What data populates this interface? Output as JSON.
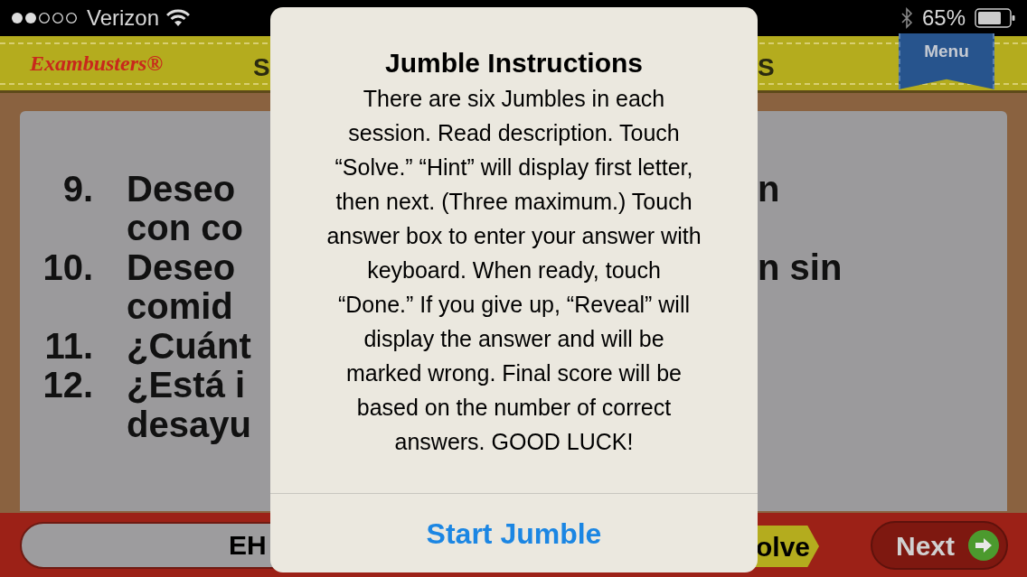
{
  "status_bar": {
    "carrier": "Verizon",
    "battery": "65%"
  },
  "header": {
    "logo": "Exambusters®",
    "title_left_fragment": "S",
    "title_right_fragment": "S",
    "menu": "Menu"
  },
  "items": [
    {
      "number": "9.",
      "lines": [
        {
          "left": "Deseo",
          "right": "n"
        },
        {
          "left": "con co"
        }
      ]
    },
    {
      "number": "10.",
      "lines": [
        {
          "left": "Deseo",
          "right": "n sin"
        },
        {
          "left": "comid"
        }
      ]
    },
    {
      "number": "11.",
      "lines": [
        {
          "left": "¿Cuánt"
        }
      ]
    },
    {
      "number": "12.",
      "lines": [
        {
          "left": "¿Está i"
        },
        {
          "left": "desayu"
        }
      ]
    }
  ],
  "bottom_bar": {
    "answer_field": "EH",
    "solve_button": "olve",
    "next_button": "Next"
  },
  "alert": {
    "title": "Jumble Instructions",
    "message": "There are six Jumbles in each session. Read description. Touch “Solve.” “Hint” will display first letter, then next. (Three maximum.) Touch answer box to enter your answer with keyboard. When ready, touch “Done.” If you give up, “Reveal” will display the answer and will be marked wrong. Final score will be based on the number of correct answers. GOOD LUCK!",
    "button": "Start Jumble"
  }
}
